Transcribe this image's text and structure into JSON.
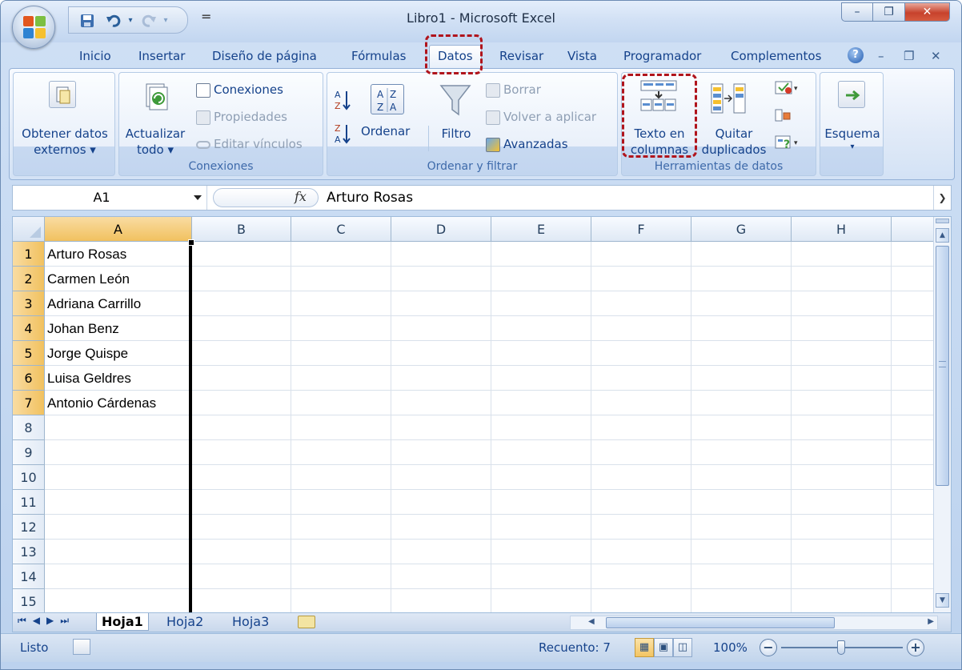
{
  "window": {
    "title": "Libro1 - Microsoft Excel",
    "controls": {
      "minimize": "–",
      "restore": "❐",
      "close": "✕"
    }
  },
  "qat": {
    "save_icon": "save-icon",
    "undo_icon": "undo-icon",
    "redo_icon": "redo-icon",
    "customize": "="
  },
  "tabs": [
    {
      "label": "Inicio"
    },
    {
      "label": "Insertar"
    },
    {
      "label": "Diseño de página"
    },
    {
      "label": "Fórmulas"
    },
    {
      "label": "Datos",
      "active": true
    },
    {
      "label": "Revisar"
    },
    {
      "label": "Vista"
    },
    {
      "label": "Programador"
    },
    {
      "label": "Complementos"
    }
  ],
  "help": "?",
  "mdi": {
    "minimize": "–",
    "restore": "❐",
    "close": "✕"
  },
  "ribbon": {
    "external": {
      "label_line1": "Obtener datos",
      "label_line2": "externos ▾"
    },
    "connections": {
      "group_label": "Conexiones",
      "refresh_line1": "Actualizar",
      "refresh_line2": "todo ▾",
      "connections": "Conexiones",
      "properties": "Propiedades",
      "edit_links": "Editar vínculos"
    },
    "sort_filter": {
      "group_label": "Ordenar y filtrar",
      "sort_az": "A↓Z",
      "sort_za": "Z↓A",
      "sort": "Ordenar",
      "filter": "Filtro",
      "clear": "Borrar",
      "reapply": "Volver a aplicar",
      "advanced": "Avanzadas"
    },
    "data_tools": {
      "group_label": "Herramientas de datos",
      "text_to_columns_line1": "Texto en",
      "text_to_columns_line2": "columnas",
      "remove_dup_line1": "Quitar",
      "remove_dup_line2": "duplicados"
    },
    "outline": {
      "label": "Esquema",
      "arrow": "▾"
    }
  },
  "formula_bar": {
    "name_box": "A1",
    "fx": "fx",
    "content": "Arturo Rosas"
  },
  "grid": {
    "columns": [
      "A",
      "B",
      "C",
      "D",
      "E",
      "F",
      "G",
      "H"
    ],
    "rows": [
      "1",
      "2",
      "3",
      "4",
      "5",
      "6",
      "7",
      "8",
      "9",
      "10",
      "11",
      "12",
      "13",
      "14",
      "15"
    ],
    "cells_a": [
      "Arturo Rosas",
      "Carmen León",
      "Adriana Carrillo",
      "Johan Benz",
      "Jorge Quispe",
      "Luisa Geldres",
      "Antonio Cárdenas"
    ]
  },
  "sheets": [
    {
      "label": "Hoja1",
      "active": true
    },
    {
      "label": "Hoja2"
    },
    {
      "label": "Hoja3"
    }
  ],
  "status": {
    "ready": "Listo",
    "count": "Recuento: 7",
    "zoom": "100%",
    "zoom_out": "−",
    "zoom_in": "+"
  },
  "colors": {
    "highlight": "#b0141c",
    "selection": "#f1c15f",
    "ribbon_text": "#15428b"
  }
}
